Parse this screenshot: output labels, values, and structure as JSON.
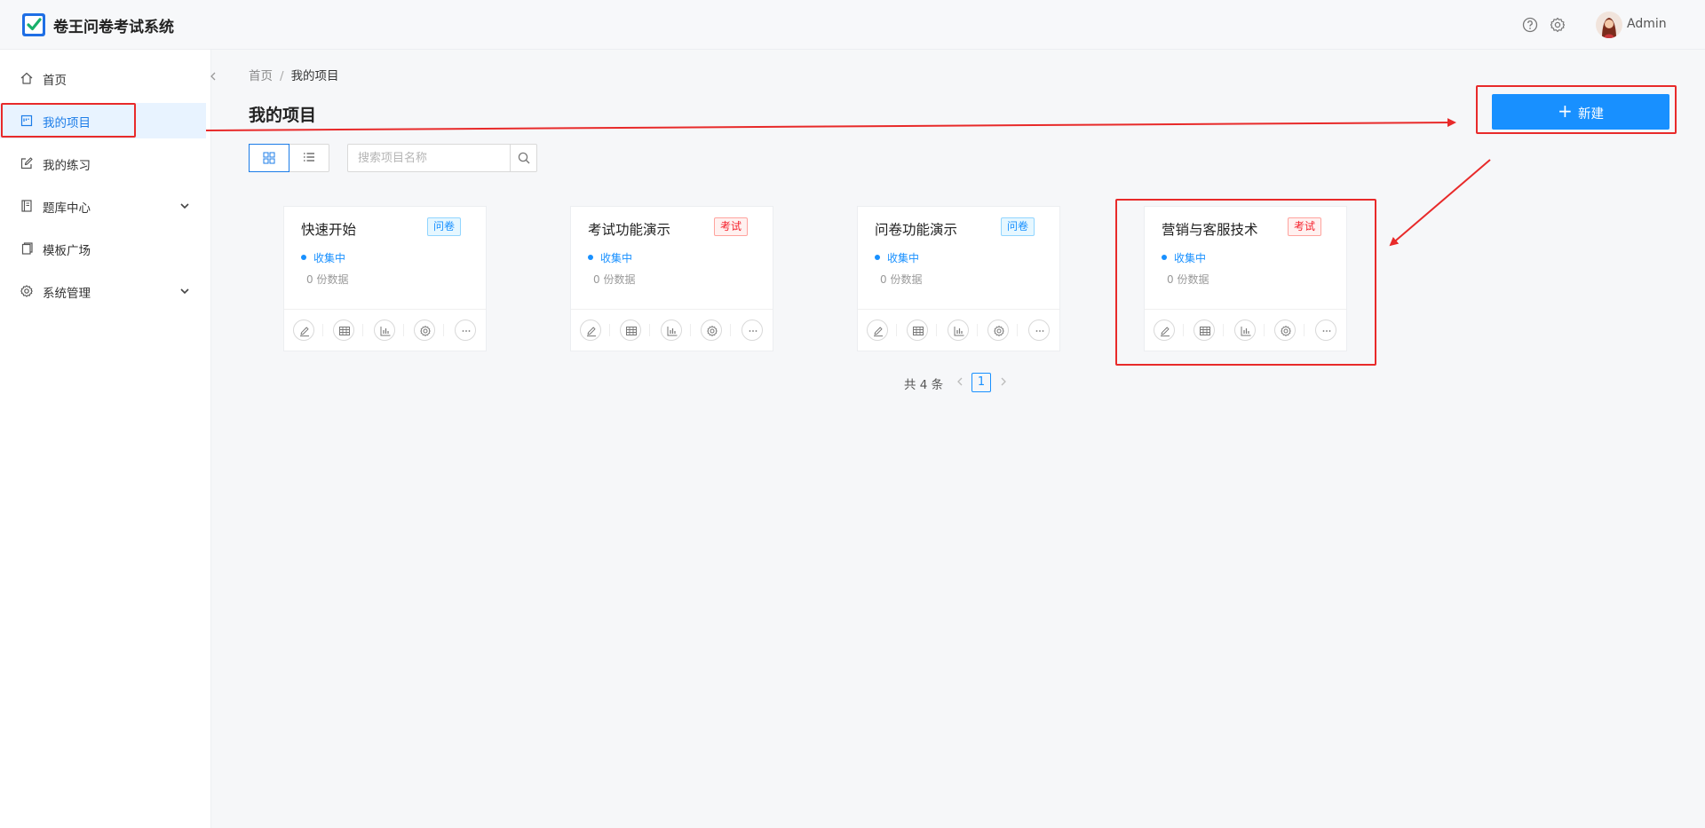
{
  "header": {
    "app_title": "卷王问卷考试系统",
    "username": "Admin",
    "icons": [
      "help-icon",
      "gear-icon",
      "avatar"
    ]
  },
  "sidebar": {
    "items": [
      {
        "label": "首页",
        "icon": "home-icon",
        "active": false
      },
      {
        "label": "我的项目",
        "icon": "project-icon",
        "active": true
      },
      {
        "label": "我的练习",
        "icon": "edit-icon",
        "active": false
      },
      {
        "label": "题库中心",
        "icon": "book-icon",
        "active": false,
        "expandable": true
      },
      {
        "label": "模板广场",
        "icon": "template-icon",
        "active": false
      },
      {
        "label": "系统管理",
        "icon": "gear-icon",
        "active": false,
        "expandable": true
      }
    ]
  },
  "breadcrumb": {
    "home": "首页",
    "separator": "/",
    "current": "我的项目"
  },
  "page_title": "我的项目",
  "toolbar": {
    "search_placeholder": "搜索项目名称",
    "new_label": "新建"
  },
  "cards": [
    {
      "title": "快速开始",
      "tag": "问卷",
      "tag_type": "survey",
      "status": "收集中",
      "count": "0 份数据"
    },
    {
      "title": "考试功能演示",
      "tag": "考试",
      "tag_type": "exam",
      "status": "收集中",
      "count": "0 份数据"
    },
    {
      "title": "问卷功能演示",
      "tag": "问卷",
      "tag_type": "survey",
      "status": "收集中",
      "count": "0 份数据"
    },
    {
      "title": "营销与客服技术",
      "tag": "考试",
      "tag_type": "exam",
      "status": "收集中",
      "count": "0 份数据"
    }
  ],
  "card_actions": [
    "edit-icon",
    "table-icon",
    "chart-icon",
    "settings-icon",
    "more-icon"
  ],
  "pagination": {
    "total": "共 4 条",
    "current_page": "1"
  },
  "colors": {
    "primary": "#1890ff",
    "annotation": "#e82a2a",
    "exam_tag": "#f5222d"
  }
}
